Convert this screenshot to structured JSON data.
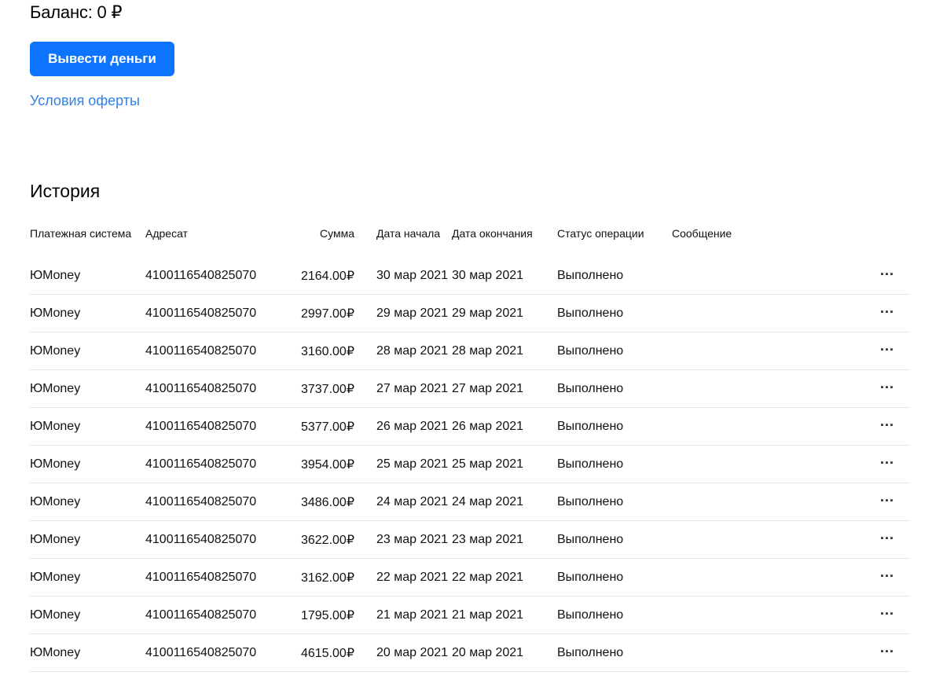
{
  "balance": {
    "text": "Баланс: 0 ₽"
  },
  "actions": {
    "withdraw_label": "Вывести деньги",
    "offer_link": "Условия оферты"
  },
  "history": {
    "title": "История",
    "columns": {
      "payment_system": "Платежная система",
      "recipient": "Адресат",
      "amount": "Сумма",
      "start_date": "Дата начала",
      "end_date": "Дата окончания",
      "status": "Статус операции",
      "message": "Сообщение"
    },
    "rows": [
      {
        "system": "ЮMoney",
        "recipient": "4100116540825070",
        "amount": "2164.00₽",
        "start": "30 мар 2021",
        "end": "30 мар 2021",
        "status": "Выполнено",
        "message": ""
      },
      {
        "system": "ЮMoney",
        "recipient": "4100116540825070",
        "amount": "2997.00₽",
        "start": "29 мар 2021",
        "end": "29 мар 2021",
        "status": "Выполнено",
        "message": ""
      },
      {
        "system": "ЮMoney",
        "recipient": "4100116540825070",
        "amount": "3160.00₽",
        "start": "28 мар 2021",
        "end": "28 мар 2021",
        "status": "Выполнено",
        "message": ""
      },
      {
        "system": "ЮMoney",
        "recipient": "4100116540825070",
        "amount": "3737.00₽",
        "start": "27 мар 2021",
        "end": "27 мар 2021",
        "status": "Выполнено",
        "message": ""
      },
      {
        "system": "ЮMoney",
        "recipient": "4100116540825070",
        "amount": "5377.00₽",
        "start": "26 мар 2021",
        "end": "26 мар 2021",
        "status": "Выполнено",
        "message": ""
      },
      {
        "system": "ЮMoney",
        "recipient": "4100116540825070",
        "amount": "3954.00₽",
        "start": "25 мар 2021",
        "end": "25 мар 2021",
        "status": "Выполнено",
        "message": ""
      },
      {
        "system": "ЮMoney",
        "recipient": "4100116540825070",
        "amount": "3486.00₽",
        "start": "24 мар 2021",
        "end": "24 мар 2021",
        "status": "Выполнено",
        "message": ""
      },
      {
        "system": "ЮMoney",
        "recipient": "4100116540825070",
        "amount": "3622.00₽",
        "start": "23 мар 2021",
        "end": "23 мар 2021",
        "status": "Выполнено",
        "message": ""
      },
      {
        "system": "ЮMoney",
        "recipient": "4100116540825070",
        "amount": "3162.00₽",
        "start": "22 мар 2021",
        "end": "22 мар 2021",
        "status": "Выполнено",
        "message": ""
      },
      {
        "system": "ЮMoney",
        "recipient": "4100116540825070",
        "amount": "1795.00₽",
        "start": "21 мар 2021",
        "end": "21 мар 2021",
        "status": "Выполнено",
        "message": ""
      },
      {
        "system": "ЮMoney",
        "recipient": "4100116540825070",
        "amount": "4615.00₽",
        "start": "20 мар 2021",
        "end": "20 мар 2021",
        "status": "Выполнено",
        "message": ""
      }
    ],
    "row_menu_icon": "more-horizontal-icon"
  },
  "colors": {
    "primary_button": "#0d74ff",
    "link": "#2f80ed",
    "divider": "#e6e6e6"
  }
}
